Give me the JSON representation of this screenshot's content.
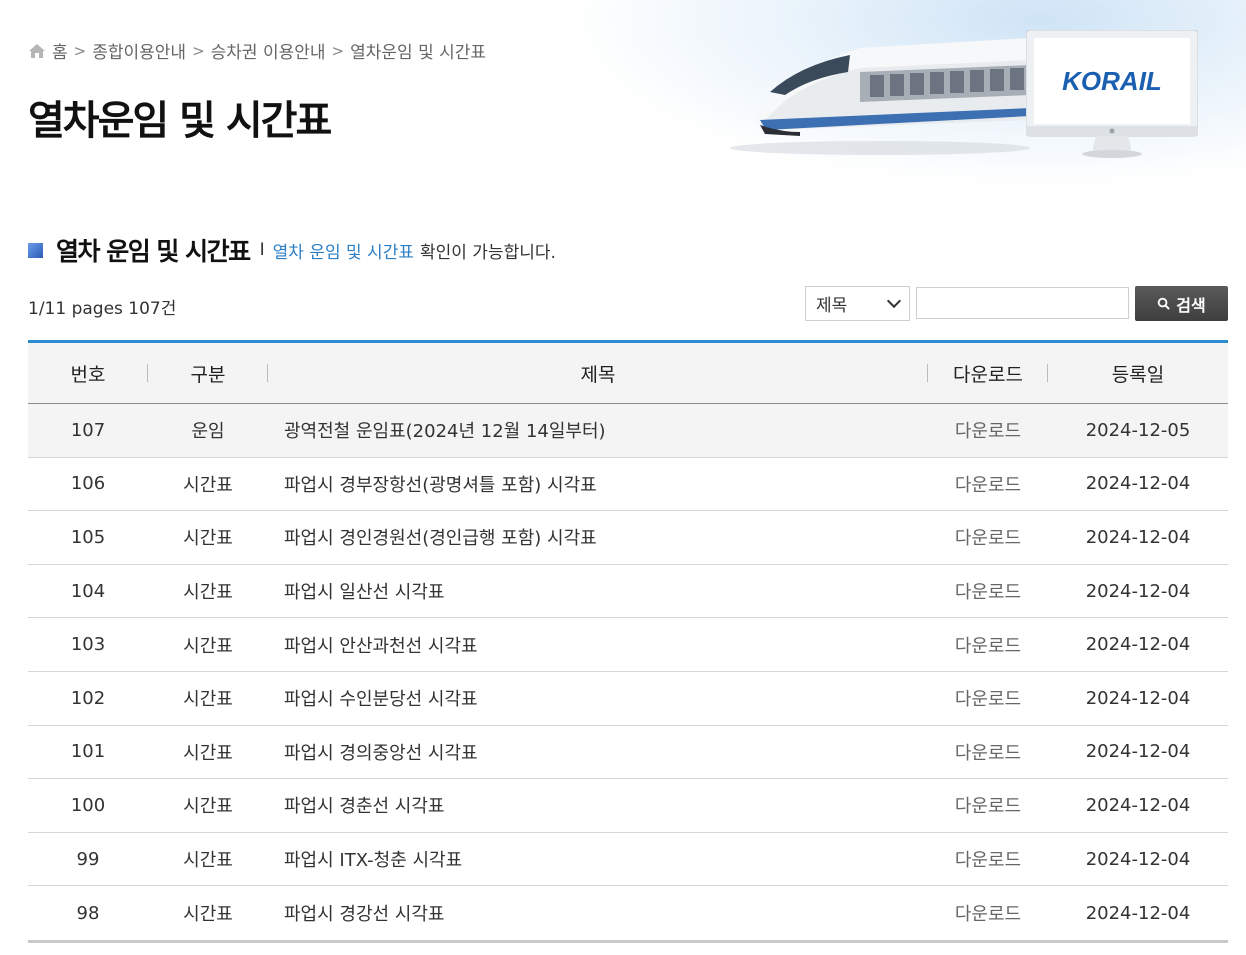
{
  "breadcrumb": {
    "home": "홈",
    "items": [
      "종합이용안내",
      "승차권 이용안내",
      "열차운임 및 시간표"
    ],
    "separator": ">"
  },
  "page_title": "열차운임 및 시간표",
  "logo_text": "KORAIL",
  "section": {
    "title": "열차 운임 및 시간표",
    "divider": "I",
    "desc_link": "열차 운임 및 시간표",
    "desc_rest": "확인이 가능합니다."
  },
  "count_text": "1/11 pages 107건",
  "search": {
    "select_value": "제목",
    "input_value": "",
    "button_label": "검색"
  },
  "table": {
    "headers": [
      "번호",
      "구분",
      "제목",
      "다운로드",
      "등록일"
    ],
    "rows": [
      {
        "no": "107",
        "cat": "운임",
        "title": "광역전철 운임표(2024년 12월 14일부터)",
        "dl": "다운로드",
        "date": "2024-12-05"
      },
      {
        "no": "106",
        "cat": "시간표",
        "title": "파업시 경부장항선(광명셔틀 포함) 시각표",
        "dl": "다운로드",
        "date": "2024-12-04"
      },
      {
        "no": "105",
        "cat": "시간표",
        "title": "파업시 경인경원선(경인급행 포함) 시각표",
        "dl": "다운로드",
        "date": "2024-12-04"
      },
      {
        "no": "104",
        "cat": "시간표",
        "title": "파업시 일산선 시각표",
        "dl": "다운로드",
        "date": "2024-12-04"
      },
      {
        "no": "103",
        "cat": "시간표",
        "title": "파업시 안산과천선 시각표",
        "dl": "다운로드",
        "date": "2024-12-04"
      },
      {
        "no": "102",
        "cat": "시간표",
        "title": "파업시 수인분당선 시각표",
        "dl": "다운로드",
        "date": "2024-12-04"
      },
      {
        "no": "101",
        "cat": "시간표",
        "title": "파업시 경의중앙선 시각표",
        "dl": "다운로드",
        "date": "2024-12-04"
      },
      {
        "no": "100",
        "cat": "시간표",
        "title": "파업시 경춘선 시각표",
        "dl": "다운로드",
        "date": "2024-12-04"
      },
      {
        "no": "99",
        "cat": "시간표",
        "title": "파업시 ITX-청춘 시각표",
        "dl": "다운로드",
        "date": "2024-12-04"
      },
      {
        "no": "98",
        "cat": "시간표",
        "title": "파업시 경강선 시각표",
        "dl": "다운로드",
        "date": "2024-12-04"
      }
    ]
  },
  "colors": {
    "accent_blue": "#2d8dd3",
    "link_blue": "#2c7fc5",
    "search_button": "#444444"
  }
}
